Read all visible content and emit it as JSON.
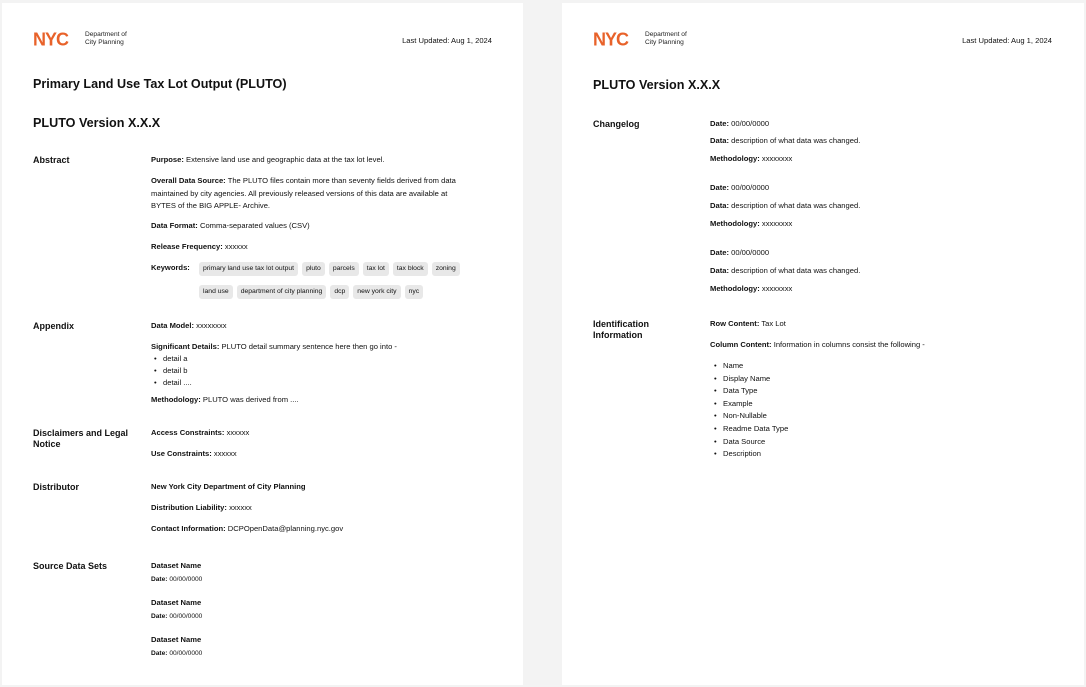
{
  "brand": {
    "logo_text": "NYC",
    "dept_line1": "Department of",
    "dept_line2": "City Planning",
    "color": "#E8622A"
  },
  "last_updated": "Last Updated: Aug 1, 2024",
  "page1": {
    "title": "Primary Land Use Tax Lot Output (PLUTO)",
    "version": "PLUTO Version X.X.X",
    "abstract": {
      "label": "Abstract",
      "purpose_label": "Purpose:",
      "purpose_value": "Extensive land use and geographic data at the tax lot level.",
      "source_label": "Overall Data Source:",
      "source_line1": "The PLUTO files contain more than seventy fields derived from data",
      "source_line2": "maintained by city agencies. All previously released versions of this data are available at",
      "source_line3": "BYTES of the BIG APPLE- Archive.",
      "format_label": "Data Format:",
      "format_value": "Comma-separated values (CSV)",
      "frequency_label": "Release Frequency:",
      "frequency_value": "xxxxxx",
      "keywords_label": "Keywords:",
      "keywords_row1": [
        "primary land use tax lot output",
        "pluto",
        "parcels",
        "tax lot",
        "tax block",
        "zoning"
      ],
      "keywords_row2": [
        "land use",
        "department of city planning",
        "dcp",
        "new york city",
        "nyc"
      ]
    },
    "appendix": {
      "label": "Appendix",
      "model_label": "Data Model:",
      "model_value": "xxxxxxxx",
      "details_label": "Significant Details:",
      "details_value": "PLUTO detail summary sentence here then go into -",
      "details_items": [
        "detail a",
        "detail b",
        "detail ...."
      ],
      "methodology_label": "Methodology:",
      "methodology_value": "PLUTO was derived from ...."
    },
    "disclaimers": {
      "label_line1": "Disclaimers and Legal",
      "label_line2": "Notice",
      "access_label": "Access Constraints:",
      "access_value": "xxxxxx",
      "use_label": "Use Constraints:",
      "use_value": "xxxxxx"
    },
    "distributor": {
      "label": "Distributor",
      "name": "New York City Department of City Planning",
      "liability_label": "Distribution Liability:",
      "liability_value": "xxxxxx",
      "contact_label": "Contact Information:",
      "contact_value": "DCPOpenData@planning.nyc.gov"
    },
    "source_data_sets": {
      "label": "Source Data Sets",
      "datasets": [
        {
          "name": "Dataset Name",
          "date_label": "Date:",
          "date_value": "00/00/0000"
        },
        {
          "name": "Dataset Name",
          "date_label": "Date:",
          "date_value": "00/00/0000"
        },
        {
          "name": "Dataset Name",
          "date_label": "Date:",
          "date_value": "00/00/0000"
        }
      ]
    }
  },
  "page2": {
    "version": "PLUTO Version X.X.X",
    "changelog": {
      "label": "Changelog",
      "entries": [
        {
          "date_label": "Date:",
          "date_value": "00/00/0000",
          "data_label": "Data:",
          "data_value": "description of what data was changed.",
          "method_label": "Methodology:",
          "method_value": "xxxxxxxx"
        },
        {
          "date_label": "Date:",
          "date_value": "00/00/0000",
          "data_label": "Data:",
          "data_value": "description of what data was changed.",
          "method_label": "Methodology:",
          "method_value": "xxxxxxxx"
        },
        {
          "date_label": "Date:",
          "date_value": "00/00/0000",
          "data_label": "Data:",
          "data_value": "description of what data was changed.",
          "method_label": "Methodology:",
          "method_value": "xxxxxxxx"
        }
      ]
    },
    "identification": {
      "label_line1": "Identification",
      "label_line2": "Information",
      "row_label": "Row Content:",
      "row_value": "Tax Lot",
      "column_label": "Column Content:",
      "column_value": "Information in columns consist the following -",
      "columns": [
        "Name",
        "Display Name",
        "Data Type",
        "Example",
        "Non-Nullable",
        "Readme Data Type",
        "Data Source",
        "Description"
      ]
    }
  }
}
